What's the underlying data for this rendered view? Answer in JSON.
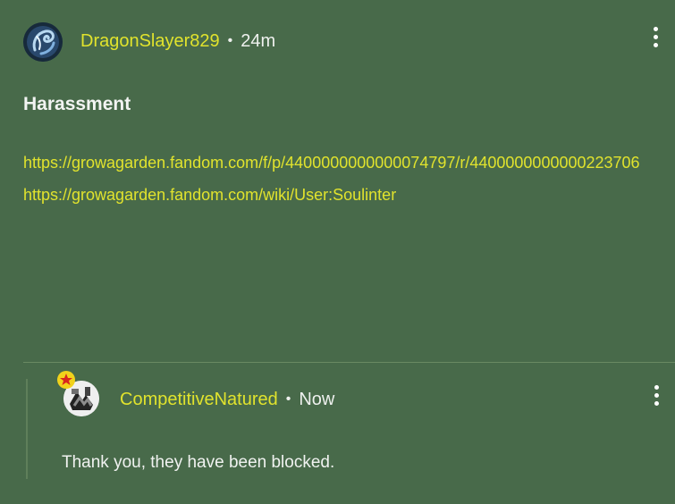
{
  "post": {
    "author": {
      "username": "DragonSlayer829",
      "avatar_icon": "dragon-avatar-icon"
    },
    "timestamp": "24m",
    "title": "Harassment",
    "links": [
      "https://growagarden.fandom.com/f/p/4400000000000074797/r/4400000000000223706",
      "https://growagarden.fandom.com/wiki/User:Soulinter"
    ],
    "more_menu_icon": "more-vertical-icon"
  },
  "reply": {
    "author": {
      "username": "CompetitiveNatured",
      "avatar_icon": "user-avatar-icon",
      "badge_icon": "admin-star-badge-icon"
    },
    "timestamp": "Now",
    "text": "Thank you, they have been blocked.",
    "more_menu_icon": "more-vertical-icon"
  },
  "colors": {
    "background": "#486a4a",
    "username": "#e1e32d",
    "link": "#e1e32d",
    "text": "#f0f2f0",
    "divider": "#6a8a63"
  }
}
